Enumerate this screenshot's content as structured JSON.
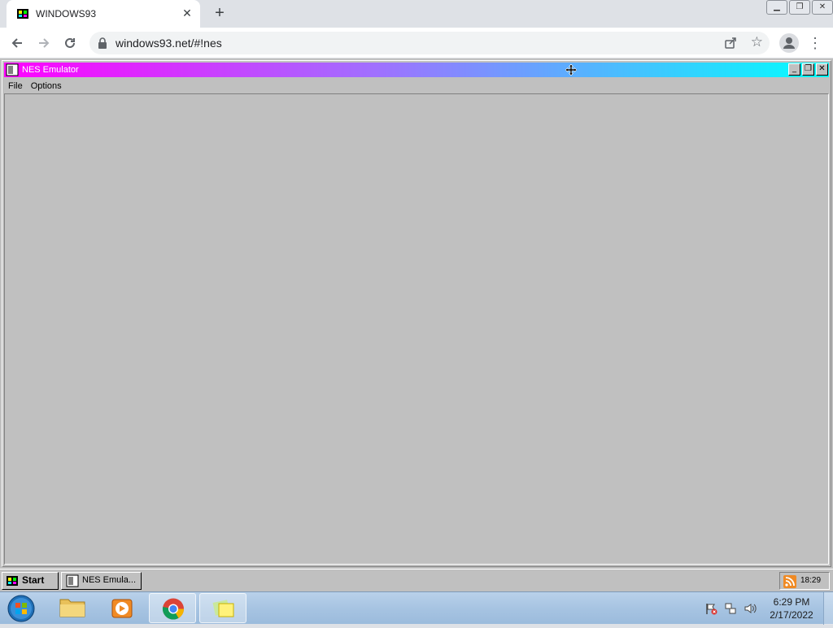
{
  "browser": {
    "tab_title": "WINDOWS93",
    "tab_close": "✕",
    "new_tab": "+",
    "url": "windows93.net/#!nes",
    "window_controls": [
      "minimize",
      "restore",
      "close"
    ]
  },
  "emulator": {
    "title": "NES Emulator",
    "menu": [
      "File",
      "Options"
    ]
  },
  "w93_taskbar": {
    "start_label": "Start",
    "task_label": "NES Emula...",
    "clock": "18:29"
  },
  "win7_taskbar": {
    "time": "6:29 PM",
    "date": "2/17/2022",
    "apps": [
      "windows-explorer",
      "media-player",
      "chrome",
      "sticky-notes"
    ]
  },
  "colors": {
    "titlebar_start": "#ff00ff",
    "titlebar_end": "#00ffff",
    "w93_face": "#c0c0c0"
  }
}
